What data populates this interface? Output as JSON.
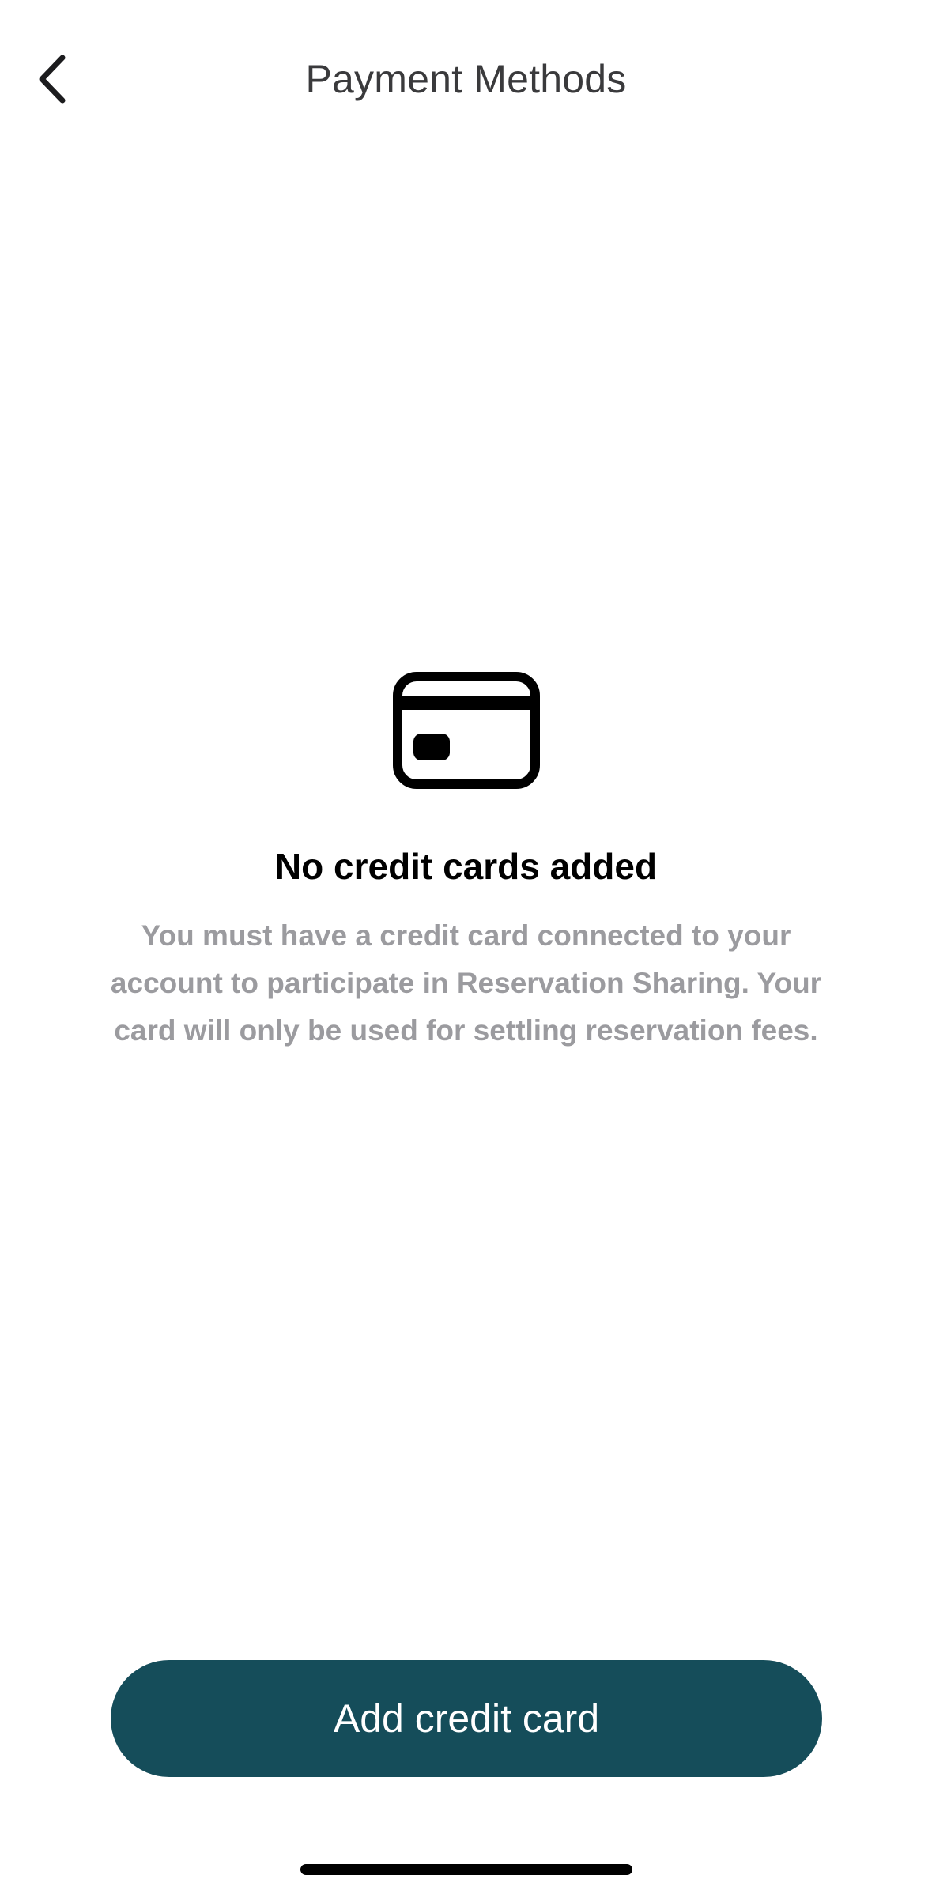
{
  "header": {
    "title": "Payment Methods",
    "back_icon": "chevron-left-icon"
  },
  "empty_state": {
    "icon": "credit-card-icon",
    "title": "No credit cards added",
    "description": "You must have a credit card connected to your account to participate in Reservation Sharing. Your card will only be used for settling reservation fees."
  },
  "actions": {
    "add_card_label": "Add credit card"
  },
  "colors": {
    "primary_button": "#154d5a",
    "secondary_text": "#9b9b9f",
    "title_text": "#3a3a3c"
  }
}
